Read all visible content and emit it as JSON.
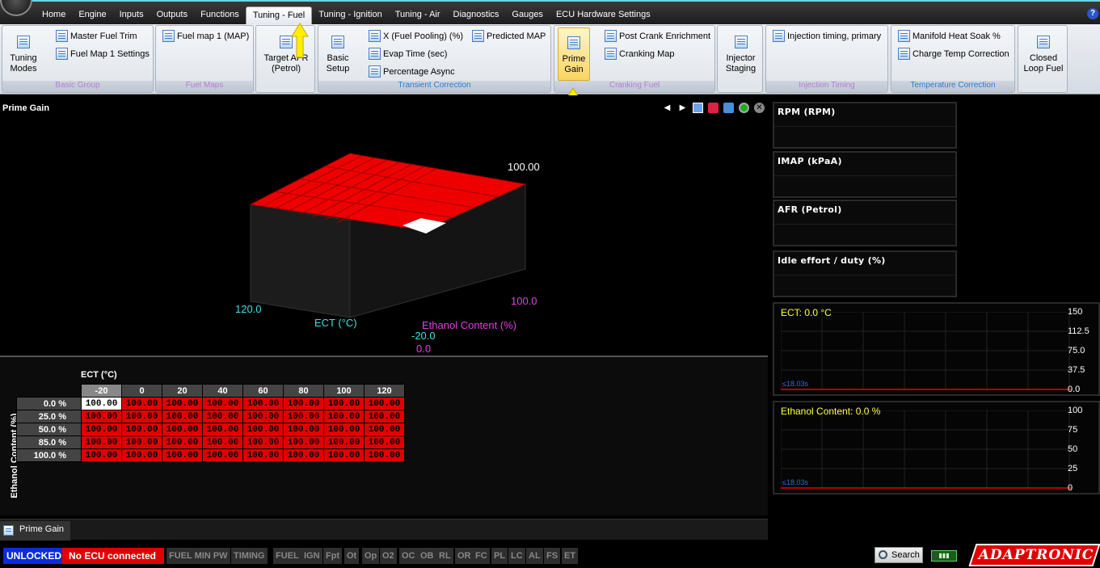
{
  "menu": {
    "tabs": [
      "Home",
      "Engine",
      "Inputs",
      "Outputs",
      "Functions",
      "Tuning - Fuel",
      "Tuning - Ignition",
      "Tuning - Air",
      "Diagnostics",
      "Gauges",
      "ECU Hardware Settings"
    ],
    "active_tab": "Tuning - Fuel",
    "help_label": "?"
  },
  "ribbon": {
    "tuning_modes": "Tuning\nModes",
    "master_fuel_trim": "Master Fuel Trim",
    "fuel_map1_settings": "Fuel Map 1 Settings",
    "basic_group": "Basic Group",
    "fuel_map1_map": "Fuel map 1 (MAP)",
    "fuel_maps_group": "Fuel Maps",
    "target_afr_l1": "Target AFR",
    "target_afr_l2": "(Petrol)",
    "basic_setup_l1": "Basic",
    "basic_setup_l2": "Setup",
    "x_fuel_pooling": "X (Fuel Pooling) (%)",
    "predicted_map": "Predicted MAP",
    "evap_time": "Evap Time (sec)",
    "percentage_async": "Percentage Async",
    "transient_group": "Transient Correction",
    "prime_gain_l1": "Prime",
    "prime_gain_l2": "Gain",
    "post_crank": "Post Crank Enrichment",
    "cranking_map": "Cranking Map",
    "cranking_group": "Cranking Fuel",
    "injector_staging_l1": "Injector",
    "injector_staging_l2": "Staging",
    "injection_timing": "Injection timing, primary",
    "injection_timing_group": "Injection Timing",
    "manifold_heat_soak": "Manifold Heat Soak %",
    "charge_temp": "Charge Temp Correction",
    "temperature_group": "Temperature Correction",
    "closed_loop_l1": "Closed",
    "closed_loop_l2": "Loop Fuel"
  },
  "panel": {
    "title": "Prime Gain",
    "plot": {
      "z_max_label": "100.00",
      "ect_axis_label": "ECT (°C)",
      "ect_max": "120.0",
      "ect_min": "-20.0",
      "eth_axis_label": "Ethanol Content (%)",
      "eth_max": "100.0",
      "eth_min": "0.0"
    },
    "table": {
      "col_axis": "ECT (°C)",
      "row_axis": "Ethanol Content (%)",
      "columns": [
        "-20",
        "0",
        "20",
        "40",
        "60",
        "80",
        "100",
        "120"
      ],
      "rows": [
        {
          "label": "0.0 %",
          "values": [
            "100.00",
            "100.00",
            "100.00",
            "100.00",
            "100.00",
            "100.00",
            "100.00",
            "100.00"
          ]
        },
        {
          "label": "25.0 %",
          "values": [
            "100.00",
            "100.00",
            "100.00",
            "100.00",
            "100.00",
            "100.00",
            "100.00",
            "100.00"
          ]
        },
        {
          "label": "50.0 %",
          "values": [
            "100.00",
            "100.00",
            "100.00",
            "100.00",
            "100.00",
            "100.00",
            "100.00",
            "100.00"
          ]
        },
        {
          "label": "85.0 %",
          "values": [
            "100.00",
            "100.00",
            "100.00",
            "100.00",
            "100.00",
            "100.00",
            "100.00",
            "100.00"
          ]
        },
        {
          "label": "100.0 %",
          "values": [
            "100.00",
            "100.00",
            "100.00",
            "100.00",
            "100.00",
            "100.00",
            "100.00",
            "100.00"
          ]
        }
      ]
    },
    "bottom_tab": "Prime Gain"
  },
  "gauges": [
    "RPM (RPM)",
    "IMAP  (kPaA)",
    "AFR (Petrol)",
    "Idle effort / duty (%)"
  ],
  "trends": [
    {
      "label": "ECT:  0.0 °C",
      "axis": [
        "150",
        "112.5",
        "75.0",
        "37.5",
        "0.0"
      ],
      "time": "≤18.03s"
    },
    {
      "label": "Ethanol Content:  0.0 %",
      "axis": [
        "100",
        "75",
        "50",
        "25",
        "0"
      ],
      "time": "≤18.03s"
    }
  ],
  "status": {
    "unlocked": "UNLOCKED",
    "ecu": "No ECU connected",
    "indicators": [
      "FUEL MIN PW",
      "TIMING",
      "FUEL",
      "IGN",
      "Fpt",
      "Ot",
      "Op",
      "O2",
      "OC",
      "OB",
      "RL",
      "OR",
      "FC",
      "PL",
      "LC",
      "AL",
      "FS",
      "ET"
    ],
    "search": "Search",
    "brand": "ADAPTRONIC"
  },
  "colors": {
    "cell_red": "#e00000",
    "ect_axis": "#40e0e0",
    "eth_axis": "#e040e0",
    "trend_label": "#ffff40",
    "unlocked_bg": "#0a2cdc"
  }
}
